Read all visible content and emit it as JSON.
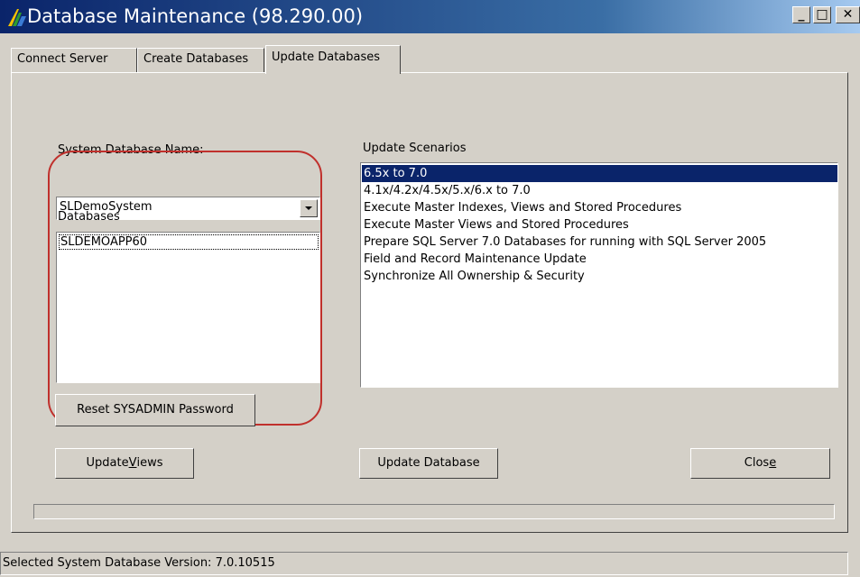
{
  "window": {
    "title": "Database Maintenance (98.290.00)",
    "controls": [
      "minimize",
      "maximize",
      "close"
    ]
  },
  "tabs": [
    {
      "label": "Connect Server",
      "active": false
    },
    {
      "label": "Create Databases",
      "active": false
    },
    {
      "label": "Update Databases",
      "active": true
    }
  ],
  "system_db": {
    "label": "System Database Name:",
    "value": "SLDemoSystem"
  },
  "databases": {
    "label": "Databases",
    "items": [
      "SLDEMOAPP60"
    ]
  },
  "scenarios": {
    "label": "Update Scenarios",
    "selected_index": 0,
    "items": [
      "6.5x to 7.0",
      "4.1x/4.2x/4.5x/5.x/6.x to 7.0",
      "Execute Master Indexes, Views and Stored Procedures",
      "Execute Master Views and Stored Procedures",
      "Prepare SQL Server 7.0 Databases for running with SQL Server 2005",
      "Field and Record Maintenance Update",
      "Synchronize All Ownership & Security"
    ]
  },
  "buttons": {
    "reset_password": "Reset SYSADMIN Password",
    "update_views_pre": "Update ",
    "update_views_accel": "V",
    "update_views_post": "iews",
    "update_database": "Update Database",
    "close_pre": "Clos",
    "close_accel": "e",
    "close_post": ""
  },
  "status": {
    "text": "Selected System Database Version: 7.0.10515"
  },
  "colors": {
    "titlebar": "#0a246a",
    "face": "#d4d0c8",
    "selection": "#0a246a",
    "highlight_ring": "#c0302c"
  }
}
